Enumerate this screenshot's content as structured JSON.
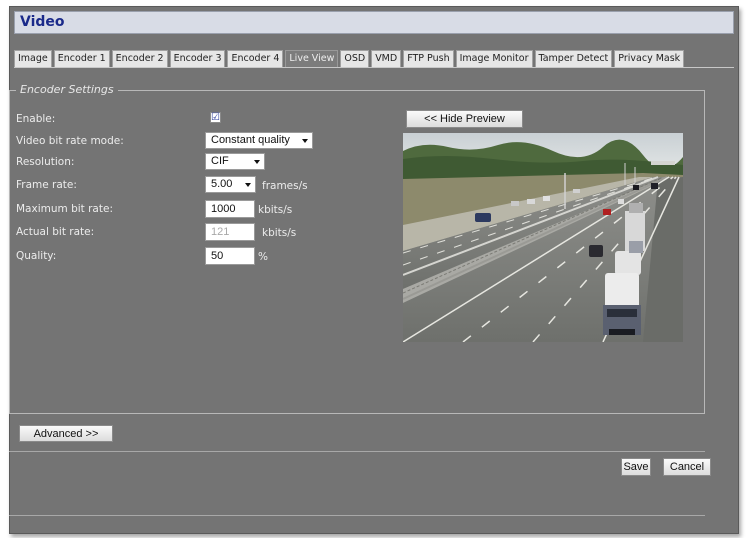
{
  "window": {
    "title": "Video"
  },
  "tabs": [
    {
      "label": "Image",
      "active": false
    },
    {
      "label": "Encoder 1",
      "active": false
    },
    {
      "label": "Encoder 2",
      "active": false
    },
    {
      "label": "Encoder 3",
      "active": false
    },
    {
      "label": "Encoder 4",
      "active": false
    },
    {
      "label": "Live View",
      "active": true
    },
    {
      "label": "OSD",
      "active": false
    },
    {
      "label": "VMD",
      "active": false
    },
    {
      "label": "FTP Push",
      "active": false
    },
    {
      "label": "Image Monitor",
      "active": false
    },
    {
      "label": "Tamper Detect",
      "active": false
    },
    {
      "label": "Privacy Mask",
      "active": false
    }
  ],
  "settings": {
    "legend": "Encoder Settings",
    "enable": {
      "label": "Enable:",
      "checked": true,
      "check_glyph": "☑"
    },
    "bitrate_mode": {
      "label": "Video bit rate mode:",
      "value": "Constant quality"
    },
    "resolution": {
      "label": "Resolution:",
      "value": "CIF"
    },
    "frame_rate": {
      "label": "Frame rate:",
      "value": "5.00",
      "unit": "frames/s"
    },
    "max_bitrate": {
      "label": "Maximum bit rate:",
      "value": "1000",
      "unit": "kbits/s"
    },
    "actual_bitrate": {
      "label": "Actual bit rate:",
      "value": "121",
      "unit": "kbits/s"
    },
    "quality": {
      "label": "Quality:",
      "value": "50",
      "unit": "%"
    }
  },
  "preview": {
    "toggle_label": "<< Hide Preview",
    "icon": "camera-preview-image"
  },
  "buttons": {
    "advanced": "Advanced >>",
    "save": "Save",
    "cancel": "Cancel"
  },
  "colors": {
    "panel_bg": "#747474",
    "title_text": "#1a2a8a",
    "active_tab": "#7c7c7c"
  }
}
